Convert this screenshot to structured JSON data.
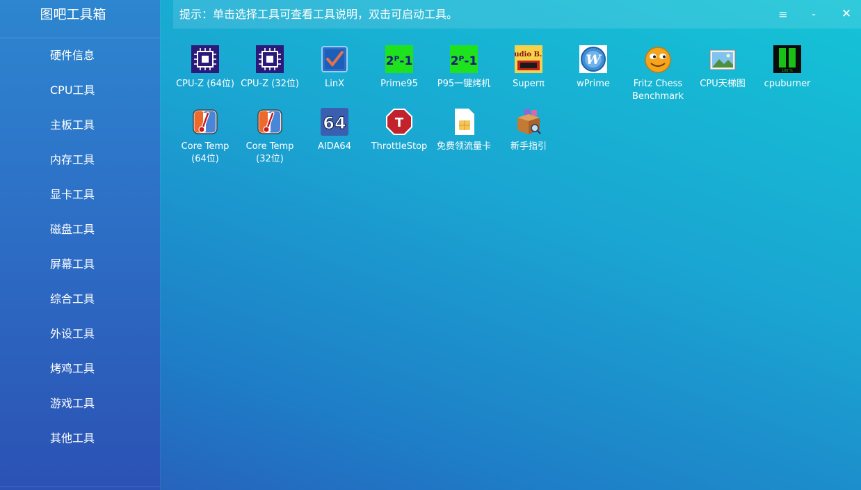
{
  "app": {
    "title": "图吧工具箱"
  },
  "sidebar": {
    "items": [
      {
        "label": "硬件信息"
      },
      {
        "label": "CPU工具"
      },
      {
        "label": "主板工具"
      },
      {
        "label": "内存工具"
      },
      {
        "label": "显卡工具"
      },
      {
        "label": "磁盘工具"
      },
      {
        "label": "屏幕工具"
      },
      {
        "label": "综合工具"
      },
      {
        "label": "外设工具"
      },
      {
        "label": "烤鸡工具"
      },
      {
        "label": "游戏工具"
      },
      {
        "label": "其他工具"
      }
    ]
  },
  "header": {
    "hint": "提示：单击选择工具可查看工具说明，双击可启动工具。",
    "menu_glyph": "≡",
    "minimize_glyph": "-",
    "close_glyph": "✕"
  },
  "tools": [
    {
      "label": "CPU-Z (64位)",
      "icon": "cpu-z-icon"
    },
    {
      "label": "CPU-Z (32位)",
      "icon": "cpu-z-icon"
    },
    {
      "label": "LinX",
      "icon": "linx-checkbox-icon"
    },
    {
      "label": "Prime95",
      "icon": "prime95-icon"
    },
    {
      "label": "P95一键烤机",
      "icon": "prime95-icon"
    },
    {
      "label": "Superπ",
      "icon": "superpi-icon"
    },
    {
      "label": "wPrime",
      "icon": "wprime-icon"
    },
    {
      "label": "Fritz Chess Benchmark",
      "icon": "fritz-smiley-icon"
    },
    {
      "label": "CPU天梯图",
      "icon": "landscape-image-icon"
    },
    {
      "label": "cpuburner",
      "icon": "cpuburner-icon"
    },
    {
      "label": "Core Temp (64位)",
      "icon": "thermometer-icon"
    },
    {
      "label": "Core Temp (32位)",
      "icon": "thermometer-icon"
    },
    {
      "label": "AIDA64",
      "icon": "aida64-icon"
    },
    {
      "label": "ThrottleStop",
      "icon": "stop-sign-icon"
    },
    {
      "label": "免费领流量卡",
      "icon": "sim-card-icon"
    },
    {
      "label": "新手指引",
      "icon": "package-box-icon"
    }
  ],
  "icon_text": {
    "prime": "2ᴾ-1",
    "superpi": "Studio B.W.",
    "wprime": "W",
    "aida": "64",
    "throttle": "T",
    "cpuburner": "100 %"
  },
  "colors": {
    "cpuz_bg": "#2c1a7a",
    "prime_bg": "#1fe21f",
    "stop_red": "#c2222c"
  }
}
